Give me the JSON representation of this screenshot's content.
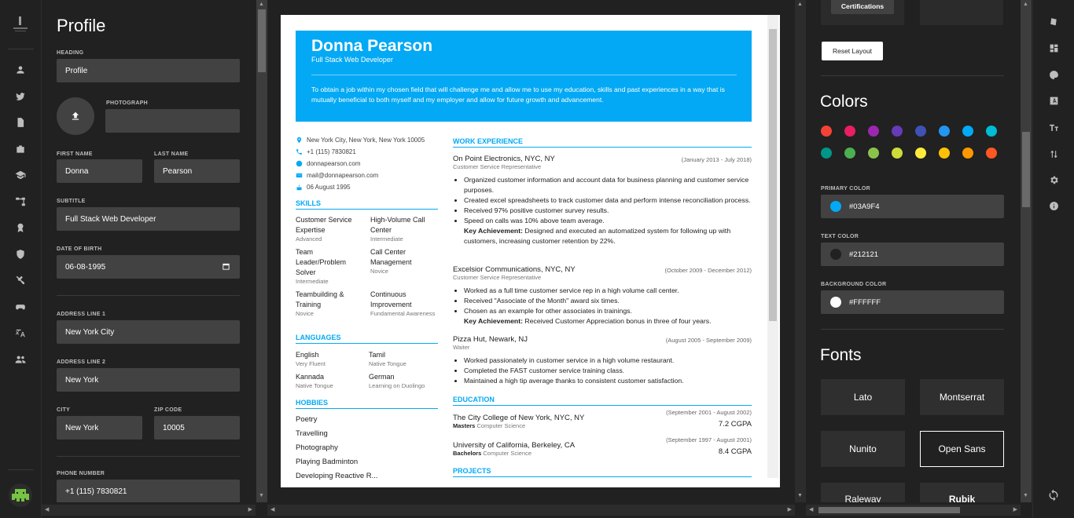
{
  "left_panel": {
    "title": "Profile",
    "heading_label": "HEADING",
    "heading_value": "Profile",
    "photograph_label": "PHOTOGRAPH",
    "first_name_label": "FIRST NAME",
    "first_name": "Donna",
    "last_name_label": "LAST NAME",
    "last_name": "Pearson",
    "subtitle_label": "SUBTITLE",
    "subtitle": "Full Stack Web Developer",
    "dob_label": "DATE OF BIRTH",
    "dob": "06-08-1995",
    "address1_label": "ADDRESS LINE 1",
    "address1": "New York City",
    "address2_label": "ADDRESS LINE 2",
    "address2": "New York",
    "city_label": "CITY",
    "city": "New York",
    "zip_label": "ZIP CODE",
    "zip": "10005",
    "phone_label": "PHONE NUMBER",
    "phone": "+1 (115) 7830821"
  },
  "resume": {
    "name": "Donna Pearson",
    "subtitle": "Full Stack Web Developer",
    "objective": "To obtain a job within my chosen field that will challenge me and allow me to use my education, skills and past experiences in a way that is mutually beneficial to both myself and my employer and allow for future growth and advancement.",
    "contact": {
      "address": "New York City, New York, New York 10005",
      "phone": "+1 (115) 7830821",
      "website": "donnapearson.com",
      "email": "mail@donnapearson.com",
      "birthdate": "06 August 1995"
    },
    "skills_heading": "SKILLS",
    "skills": [
      {
        "name": "Customer Service Expertise",
        "level": "Advanced"
      },
      {
        "name": "High-Volume Call Center",
        "level": "Intermediate"
      },
      {
        "name": "Team Leader/Problem Solver",
        "level": "Intermediate"
      },
      {
        "name": "Call Center Management",
        "level": "Novice"
      },
      {
        "name": "Teambuilding & Training",
        "level": "Novice"
      },
      {
        "name": "Continuous Improvement",
        "level": "Fundamental Awareness"
      }
    ],
    "languages_heading": "LANGUAGES",
    "languages": [
      {
        "name": "English",
        "level": "Very Fluent"
      },
      {
        "name": "Tamil",
        "level": "Native Tongue"
      },
      {
        "name": "Kannada",
        "level": "Native Tongue"
      },
      {
        "name": "German",
        "level": "Learning on Duolingo"
      }
    ],
    "hobbies_heading": "HOBBIES",
    "hobbies": [
      "Poetry",
      "Travelling",
      "Photography",
      "Playing Badminton",
      "Developing Reactive R..."
    ],
    "work_heading": "WORK EXPERIENCE",
    "work": [
      {
        "title": "On Point Electronics, NYC, NY",
        "role": "Customer Service Representative",
        "dates": "(January 2013 - July 2018)",
        "bullets": [
          "Organized customer information and account data for business planning and customer service purposes.",
          "Created excel spreadsheets to track customer data and perform intense reconciliation process.",
          "Received 97% positive customer survey results.",
          "Speed on calls was 10% above team average."
        ],
        "achievement_label": "Key Achievement:",
        "achievement": "Designed and executed an automatized system for following up with customers, increasing customer retention by 22%."
      },
      {
        "title": "Excelsior Communications, NYC, NY",
        "role": "Customer Service Representative",
        "dates": "(October 2009 - December 2012)",
        "bullets": [
          "Worked as a full time customer service rep in a high volume call center.",
          "Received \"Associate of the Month\" award six times.",
          "Chosen as an example for other associates in trainings."
        ],
        "achievement_label": "Key Achievement:",
        "achievement": "Received Customer Appreciation bonus in three of four years."
      },
      {
        "title": "Pizza Hut, Newark, NJ",
        "role": "Waiter",
        "dates": "(August 2005 - September 2009)",
        "bullets": [
          "Worked passionately in customer service in a high volume restaurant.",
          "Completed the FAST customer service training class.",
          "Maintained a high tip average thanks to consistent customer satisfaction."
        ]
      }
    ],
    "education_heading": "EDUCATION",
    "education": [
      {
        "school": "The City College of New York, NYC, NY",
        "degree": "Masters",
        "field": "Computer Science",
        "dates": "(September 2001 - August 2002)",
        "grade": "7.2 CGPA"
      },
      {
        "school": "University of California, Berkeley, CA",
        "degree": "Bachelors",
        "field": "Computer Science",
        "dates": "(September 1997 - August 2001)",
        "grade": "8.4 CGPA"
      }
    ],
    "projects_heading": "PROJECTS"
  },
  "right_panel": {
    "certifications_button": "Certifications",
    "reset_layout": "Reset Layout",
    "colors_title": "Colors",
    "palette": [
      "#f44336",
      "#e91e63",
      "#9c27b0",
      "#673ab7",
      "#3f51b5",
      "#2196f3",
      "#03a9f4",
      "#00bcd4",
      "#009688",
      "#4caf50",
      "#8bc34a",
      "#cddc39",
      "#ffeb3b",
      "#ffc107",
      "#ff9800",
      "#ff5722"
    ],
    "primary_color_label": "PRIMARY COLOR",
    "primary_color": "#03A9F4",
    "text_color_label": "TEXT COLOR",
    "text_color": "#212121",
    "background_color_label": "BACKGROUND COLOR",
    "background_color": "#FFFFFF",
    "fonts_title": "Fonts",
    "fonts": [
      "Lato",
      "Montserrat",
      "Nunito",
      "Open Sans",
      "Raleway",
      "Rubik"
    ],
    "selected_font": "Open Sans"
  }
}
